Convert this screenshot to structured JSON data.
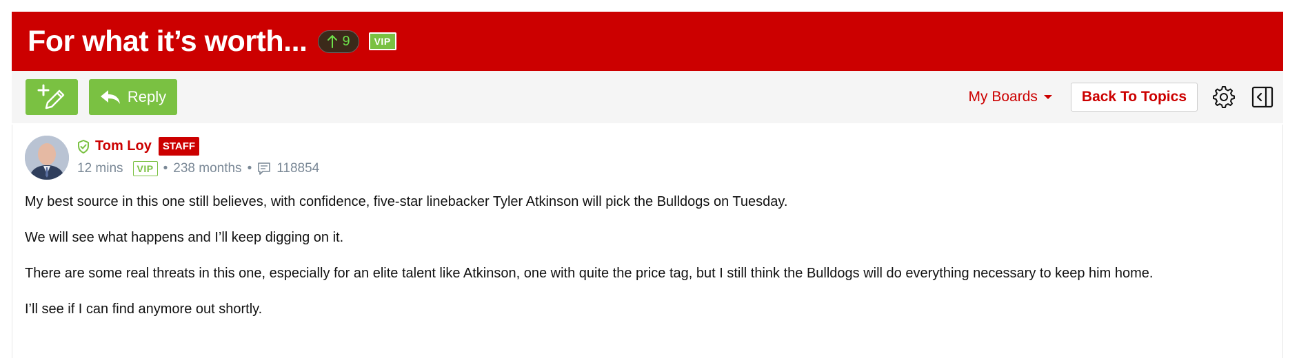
{
  "header": {
    "title": "For what it’s worth...",
    "upvote_count": "9",
    "vip_label": "VIP"
  },
  "toolbar": {
    "reply_label": "Reply",
    "my_boards_label": "My Boards",
    "back_to_topics_label": "Back To Topics"
  },
  "post": {
    "author": "Tom Loy",
    "author_badge": "STAFF",
    "time_ago": "12 mins",
    "vip_label": "VIP",
    "membership": "238 months",
    "post_count": "118854",
    "paragraphs": [
      "My best source in this one still believes, with confidence, five-star linebacker Tyler Atkinson will pick the Bulldogs on Tuesday.",
      "We will see what happens and I’ll keep digging on it.",
      "There are some real threats in this one, especially for an elite talent like Atkinson, one with quite the price tag, but I still think the Bulldogs will do everything necessary to keep him home.",
      "I’ll see if I can find anymore out shortly."
    ]
  },
  "colors": {
    "brand_red": "#cc0000",
    "action_green": "#7ac142",
    "toolbar_bg": "#f5f5f5",
    "meta_gray": "#7a8896"
  },
  "icons": {
    "upvote": "arrow-up-icon",
    "new_topic": "pencil-plus-icon",
    "reply": "reply-arrow-icon",
    "my_boards_caret": "caret-down-icon",
    "settings": "gear-icon",
    "panel": "collapse-panel-icon",
    "verified": "shield-check-icon",
    "posts": "comment-icon"
  }
}
